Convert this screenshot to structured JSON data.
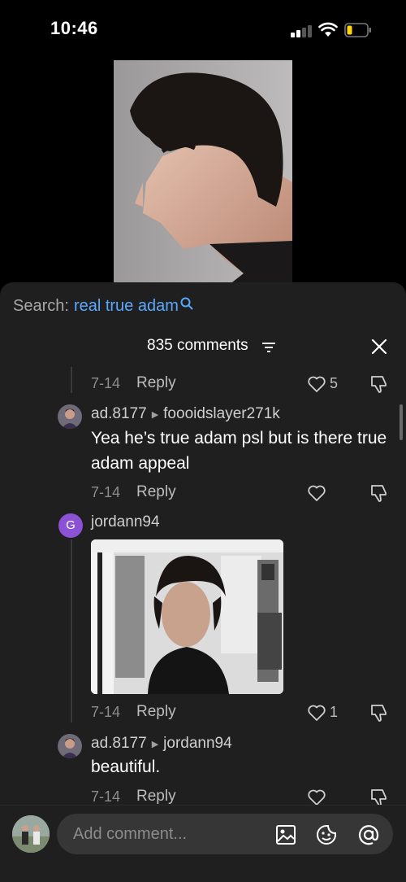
{
  "status_bar": {
    "time": "10:46"
  },
  "search": {
    "prefix": "Search:",
    "term": "real true adam"
  },
  "comments_header": {
    "count_label": "835 comments"
  },
  "comments": [
    {
      "date": "7-14",
      "reply_label": "Reply",
      "likes": "5"
    },
    {
      "author": "ad.8177",
      "reply_to": "foooidslayer271k",
      "text": "Yea he’s true adam psl but is there true adam appeal",
      "date": "7-14",
      "reply_label": "Reply",
      "likes": ""
    },
    {
      "author": "jordann94",
      "avatar_letter": "G",
      "date": "7-14",
      "reply_label": "Reply",
      "likes": "1"
    },
    {
      "author": "ad.8177",
      "reply_to": "jordann94",
      "text": "beautiful.",
      "date": "7-14",
      "reply_label": "Reply",
      "likes": ""
    }
  ],
  "input": {
    "placeholder": "Add comment..."
  },
  "icons": [
    "search-icon",
    "filter-icon",
    "close-icon",
    "heart-icon",
    "dislike-icon",
    "image-icon",
    "emoji-icon",
    "mention-icon"
  ],
  "colors": {
    "accent": "#5aa9ff",
    "sheet_bg": "#1f1f1f",
    "input_bg": "#363636",
    "avatar_letter_bg": "#8b52d6"
  }
}
